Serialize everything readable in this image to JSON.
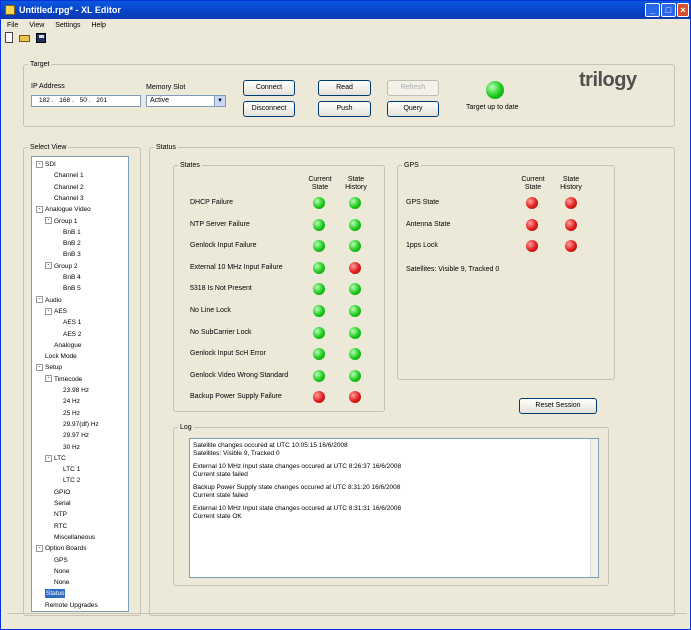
{
  "window": {
    "title": "Untitled.rpg* - XL Editor"
  },
  "menu": [
    "File",
    "View",
    "Settings",
    "Help"
  ],
  "toolbar": {
    "icons": [
      "new-document-icon",
      "open-folder-icon",
      "save-disk-icon"
    ]
  },
  "target": {
    "group_label": "Target",
    "ip_label": "IP Address",
    "ip_octets": [
      "182",
      "168",
      "50",
      "201"
    ],
    "memory_label": "Memory Slot",
    "memory_value": "Active",
    "buttons": {
      "connect": "Connect",
      "disconnect": "Disconnect",
      "read": "Read",
      "push": "Push",
      "refresh": "Refresh",
      "query": "Query"
    },
    "status_text": "Target up to date",
    "status_color": "green",
    "logo_text": "trilogy"
  },
  "select_view": {
    "label": "Select View",
    "items": [
      {
        "label": "SDI",
        "indent": 0,
        "expander": "-"
      },
      {
        "label": "Channel 1",
        "indent": 2
      },
      {
        "label": "Channel 2",
        "indent": 2
      },
      {
        "label": "Channel 3",
        "indent": 2
      },
      {
        "label": "Analogue Video",
        "indent": 0,
        "expander": "-"
      },
      {
        "label": "Group 1",
        "indent": 1,
        "expander": "-"
      },
      {
        "label": "BnB 1",
        "indent": 3
      },
      {
        "label": "BnB 2",
        "indent": 3
      },
      {
        "label": "BnB 3",
        "indent": 3
      },
      {
        "label": "Group 2",
        "indent": 1,
        "expander": "-"
      },
      {
        "label": "BnB 4",
        "indent": 3
      },
      {
        "label": "BnB 5",
        "indent": 3
      },
      {
        "label": "Audio",
        "indent": 0,
        "expander": "-"
      },
      {
        "label": "AES",
        "indent": 1,
        "expander": "-"
      },
      {
        "label": "AES 1",
        "indent": 3
      },
      {
        "label": "AES 2",
        "indent": 3
      },
      {
        "label": "Analogue",
        "indent": 2
      },
      {
        "label": "Lock Mode",
        "indent": 1
      },
      {
        "label": "Setup",
        "indent": 0,
        "expander": "-"
      },
      {
        "label": "Timecode",
        "indent": 1,
        "expander": "-"
      },
      {
        "label": "23.98 Hz",
        "indent": 3
      },
      {
        "label": "24 Hz",
        "indent": 3
      },
      {
        "label": "25 Hz",
        "indent": 3
      },
      {
        "label": "29.97(df) Hz",
        "indent": 3
      },
      {
        "label": "29.97 Hz",
        "indent": 3
      },
      {
        "label": "30 Hz",
        "indent": 3
      },
      {
        "label": "LTC",
        "indent": 1,
        "expander": "-"
      },
      {
        "label": "LTC 1",
        "indent": 3
      },
      {
        "label": "LTC 2",
        "indent": 3
      },
      {
        "label": "GPIO",
        "indent": 2
      },
      {
        "label": "Serial",
        "indent": 2
      },
      {
        "label": "NTP",
        "indent": 2
      },
      {
        "label": "RTC",
        "indent": 2
      },
      {
        "label": "Miscellaneous",
        "indent": 2
      },
      {
        "label": "Option Boards",
        "indent": 0,
        "expander": "-"
      },
      {
        "label": "GPS",
        "indent": 2
      },
      {
        "label": "None",
        "indent": 2
      },
      {
        "label": "None",
        "indent": 2
      },
      {
        "label": "Status",
        "indent": 1,
        "selected": true
      },
      {
        "label": "Remote Upgrades",
        "indent": 1
      }
    ]
  },
  "status": {
    "group_label": "Status",
    "states": {
      "label": "States",
      "col_current": "Current State",
      "col_history": "State History",
      "rows": [
        {
          "label": "DHCP Failure",
          "current": "green",
          "history": "green"
        },
        {
          "label": "NTP Server Failure",
          "current": "green",
          "history": "green"
        },
        {
          "label": "Genlock Input Failure",
          "current": "green",
          "history": "green"
        },
        {
          "label": "External 10 MHz Input Failure",
          "current": "green",
          "history": "red"
        },
        {
          "label": "5318 Is Not Present",
          "current": "green",
          "history": "green"
        },
        {
          "label": "No Line Lock",
          "current": "green",
          "history": "green"
        },
        {
          "label": "No SubCarrier Lock",
          "current": "green",
          "history": "green"
        },
        {
          "label": "Genlock Input ScH Error",
          "current": "green",
          "history": "green"
        },
        {
          "label": "Genlock Video Wrong Standard",
          "current": "green",
          "history": "green"
        },
        {
          "label": "Backup Power Supply Failure",
          "current": "red",
          "history": "red"
        }
      ]
    },
    "gps": {
      "label": "GPS",
      "col_current": "Current State",
      "col_history": "State History",
      "rows": [
        {
          "label": "GPS State",
          "current": "red",
          "history": "red"
        },
        {
          "label": "Antenna State",
          "current": "red",
          "history": "red"
        },
        {
          "label": "1pps Lock",
          "current": "red",
          "history": "red"
        }
      ],
      "satellites": "Satellites: Visible 9, Tracked 0"
    },
    "reset_button": "Reset Session",
    "log": {
      "label": "Log",
      "entries": [
        [
          "Satellite changes occured at UTC 10:05:15 16/6/2008",
          "Satellites: Visible 9, Tracked 0"
        ],
        [
          "External 10 MHz Input state changes occured at UTC 8:26:37 16/6/2008",
          "Current state failed"
        ],
        [
          "Backup Power Supply state changes occured at UTC 8:31:20 16/6/2008",
          "Current state failed"
        ],
        [
          "External 10 MHz Input state changes occured at UTC 8:31:31 16/6/2008",
          "Current state OK"
        ]
      ]
    }
  },
  "colors": {
    "green": "#19c819",
    "red": "#e01a1a",
    "title_blue": "#0842c6"
  }
}
